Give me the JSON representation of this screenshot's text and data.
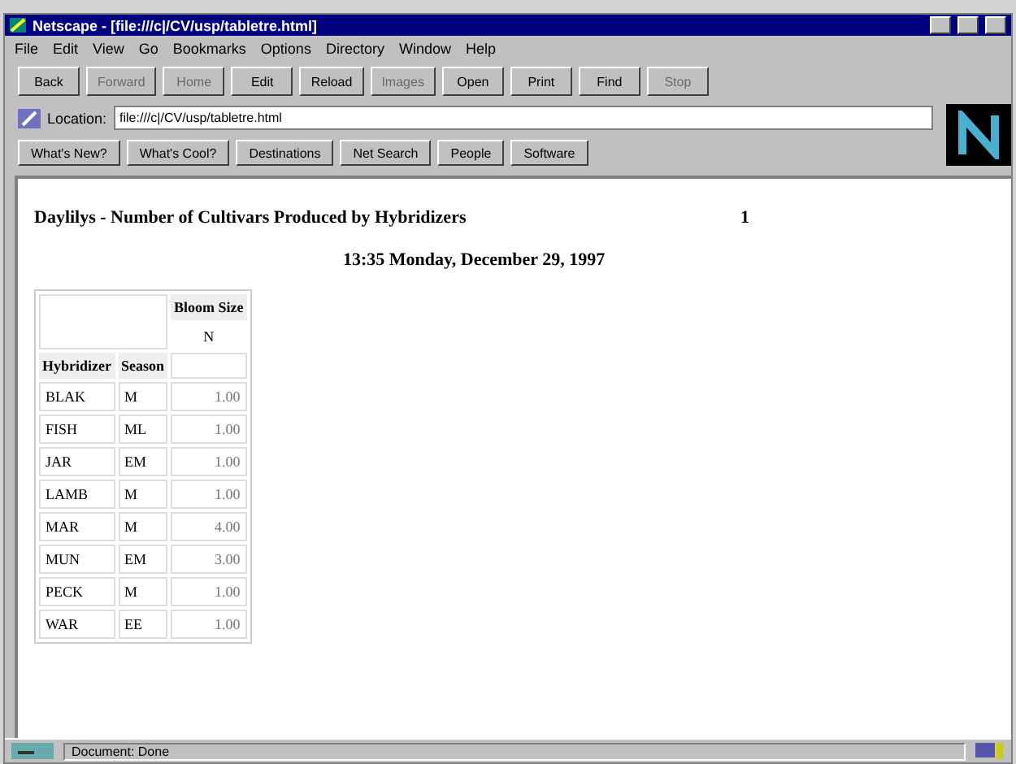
{
  "window": {
    "title": "Netscape - [file:///c|/CV/usp/tabletre.html]"
  },
  "menu": [
    "File",
    "Edit",
    "View",
    "Go",
    "Bookmarks",
    "Options",
    "Directory",
    "Window",
    "Help"
  ],
  "toolbar": [
    {
      "label": "Back",
      "disabled": false
    },
    {
      "label": "Forward",
      "disabled": true
    },
    {
      "label": "Home",
      "disabled": true
    },
    {
      "label": "Edit",
      "disabled": false
    },
    {
      "label": "Reload",
      "disabled": false
    },
    {
      "label": "Images",
      "disabled": true
    },
    {
      "label": "Open",
      "disabled": false
    },
    {
      "label": "Print",
      "disabled": false
    },
    {
      "label": "Find",
      "disabled": false
    },
    {
      "label": "Stop",
      "disabled": true
    }
  ],
  "location": {
    "label": "Location:",
    "value": "file:///c|/CV/usp/tabletre.html"
  },
  "directory_buttons": [
    "What's New?",
    "What's Cool?",
    "Destinations",
    "Net Search",
    "People",
    "Software"
  ],
  "page": {
    "title": "Daylilys - Number of Cultivars Produced by Hybridizers",
    "page_number": "1",
    "date": "13:35 Monday, December 29, 1997",
    "table": {
      "group_header": "Bloom Size",
      "stat_header": "N",
      "columns": [
        "Hybridizer",
        "Season"
      ],
      "rows": [
        [
          "BLAK",
          "M",
          "1.00"
        ],
        [
          "FISH",
          "ML",
          "1.00"
        ],
        [
          "JAR",
          "EM",
          "1.00"
        ],
        [
          "LAMB",
          "M",
          "1.00"
        ],
        [
          "MAR",
          "M",
          "4.00"
        ],
        [
          "MUN",
          "EM",
          "3.00"
        ],
        [
          "PECK",
          "M",
          "1.00"
        ],
        [
          "WAR",
          "EE",
          "1.00"
        ]
      ]
    }
  },
  "status_bar": {
    "text": "Document: Done"
  }
}
